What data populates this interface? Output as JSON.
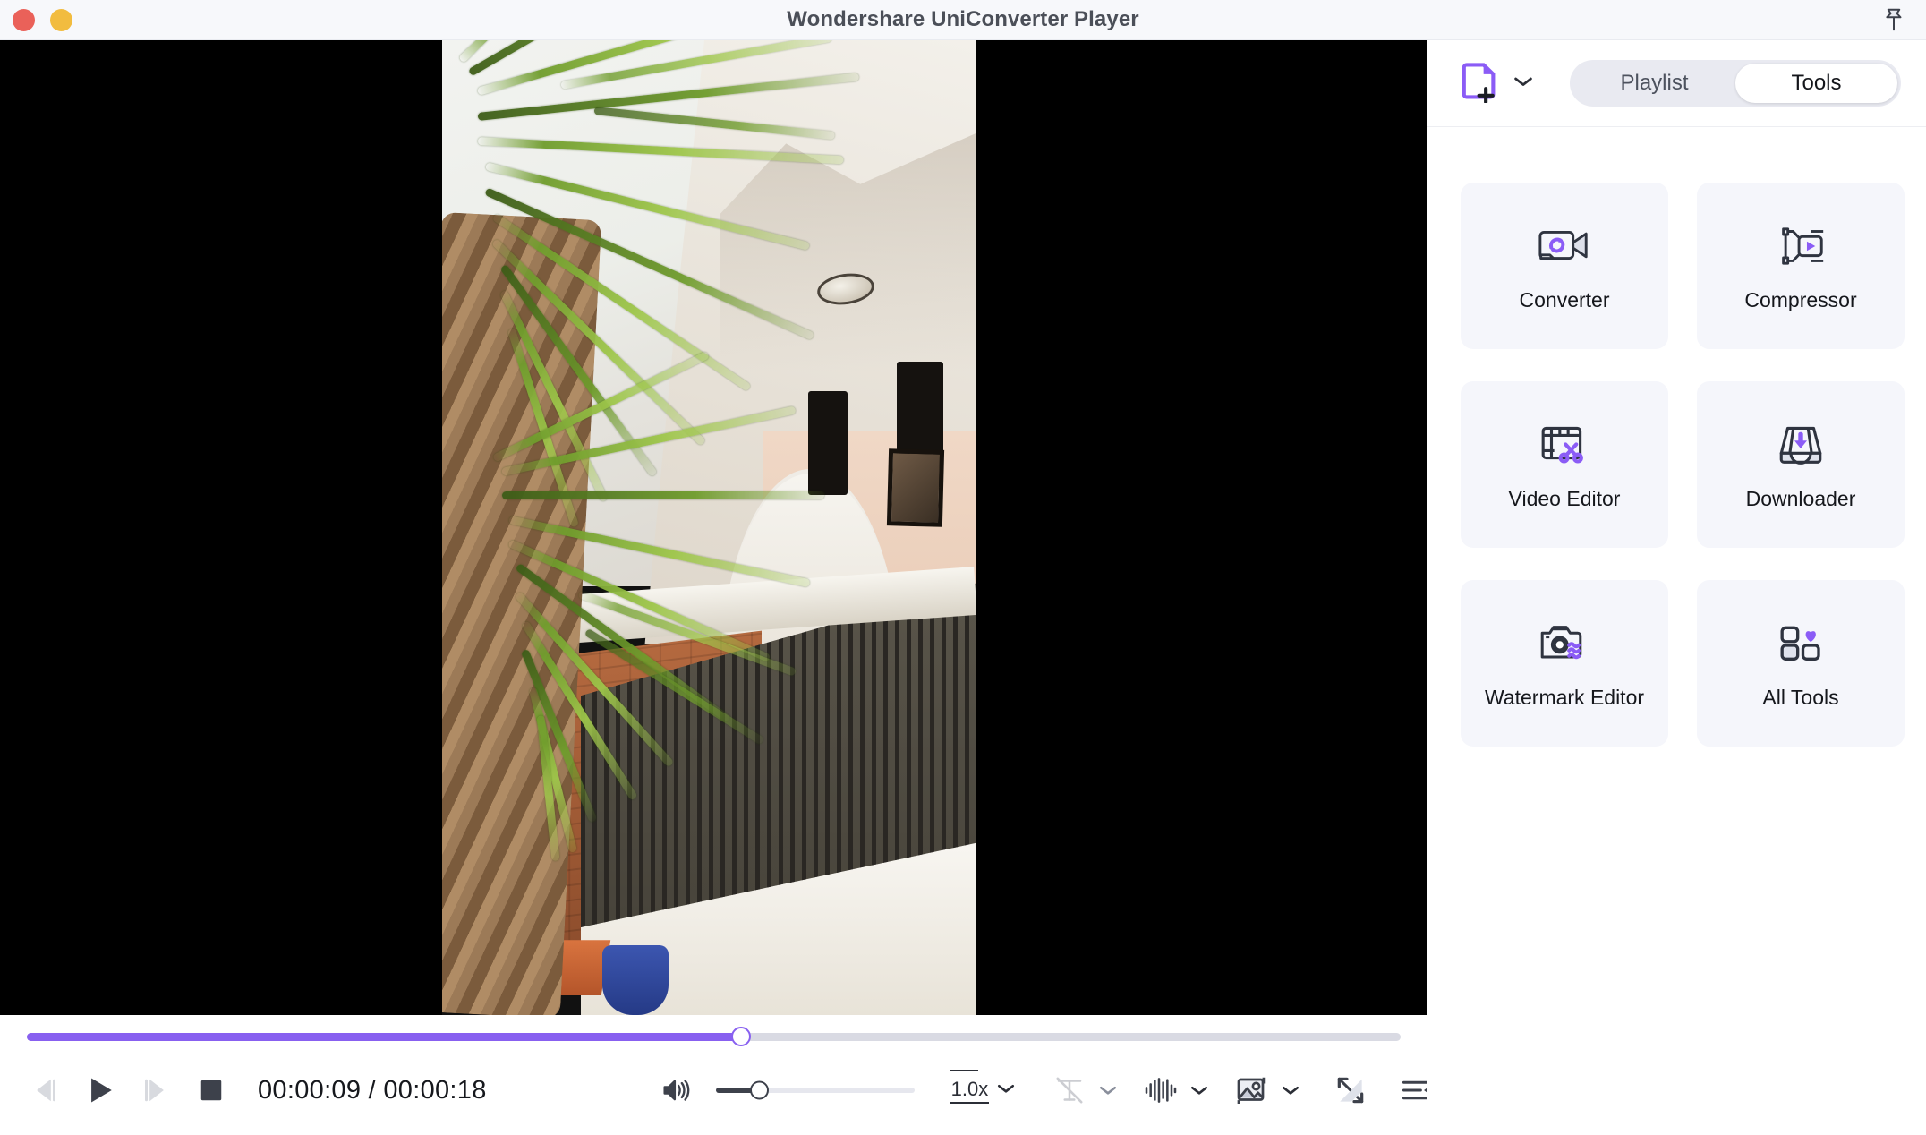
{
  "window": {
    "title": "Wondershare UniConverter Player",
    "traffic_lights": [
      "close",
      "minimize"
    ],
    "pin_icon": "pushpin-icon"
  },
  "player": {
    "time_current": "00:00:09",
    "time_separator": "/",
    "time_total": "00:00:18",
    "time_display": "00:00:09 / 00:00:18",
    "progress_percent": 52,
    "volume_percent": 22,
    "speed_label": "1.0x",
    "is_playing": false,
    "video_orientation": "portrait",
    "controls": [
      {
        "name": "previous-frame-button",
        "icon": "step-backward-icon",
        "state": "disabled"
      },
      {
        "name": "play-button",
        "icon": "play-icon",
        "state": "enabled"
      },
      {
        "name": "next-frame-button",
        "icon": "step-forward-icon",
        "state": "disabled"
      },
      {
        "name": "stop-button",
        "icon": "stop-icon",
        "state": "enabled"
      },
      {
        "name": "volume-button",
        "icon": "speaker-icon",
        "state": "enabled"
      },
      {
        "name": "speed-button",
        "icon": "speed-icon",
        "state": "enabled"
      },
      {
        "name": "subtitle-button",
        "icon": "subtitle-off-icon",
        "state": "disabled"
      },
      {
        "name": "audio-track-button",
        "icon": "waveform-icon",
        "state": "enabled"
      },
      {
        "name": "snapshot-button",
        "icon": "image-icon",
        "state": "enabled"
      },
      {
        "name": "fullscreen-button",
        "icon": "fullscreen-icon",
        "state": "enabled"
      },
      {
        "name": "playlist-toggle-button",
        "icon": "playlist-icon",
        "state": "enabled"
      }
    ]
  },
  "sidebar": {
    "add_file_icon": "add-file-icon",
    "add_file_chevron": "chevron-down-icon",
    "tabs": [
      {
        "label": "Playlist",
        "active": false
      },
      {
        "label": "Tools",
        "active": true
      }
    ],
    "tools": [
      {
        "label": "Converter",
        "icon": "converter-icon"
      },
      {
        "label": "Compressor",
        "icon": "compressor-icon"
      },
      {
        "label": "Video Editor",
        "icon": "video-editor-icon"
      },
      {
        "label": "Downloader",
        "icon": "downloader-icon"
      },
      {
        "label": "Watermark Editor",
        "icon": "watermark-editor-icon"
      },
      {
        "label": "All Tools",
        "icon": "all-tools-icon"
      }
    ]
  },
  "colors": {
    "accent_purple": "#8860f0",
    "titlebar_bg": "#f7f8fb",
    "card_bg": "#f5f6fb",
    "segment_bg": "#e9eaf1",
    "close_red": "#ea6159",
    "minimize_yellow": "#f2bc3f",
    "text_dark": "#15171c",
    "video_letterbox": "#000000"
  }
}
